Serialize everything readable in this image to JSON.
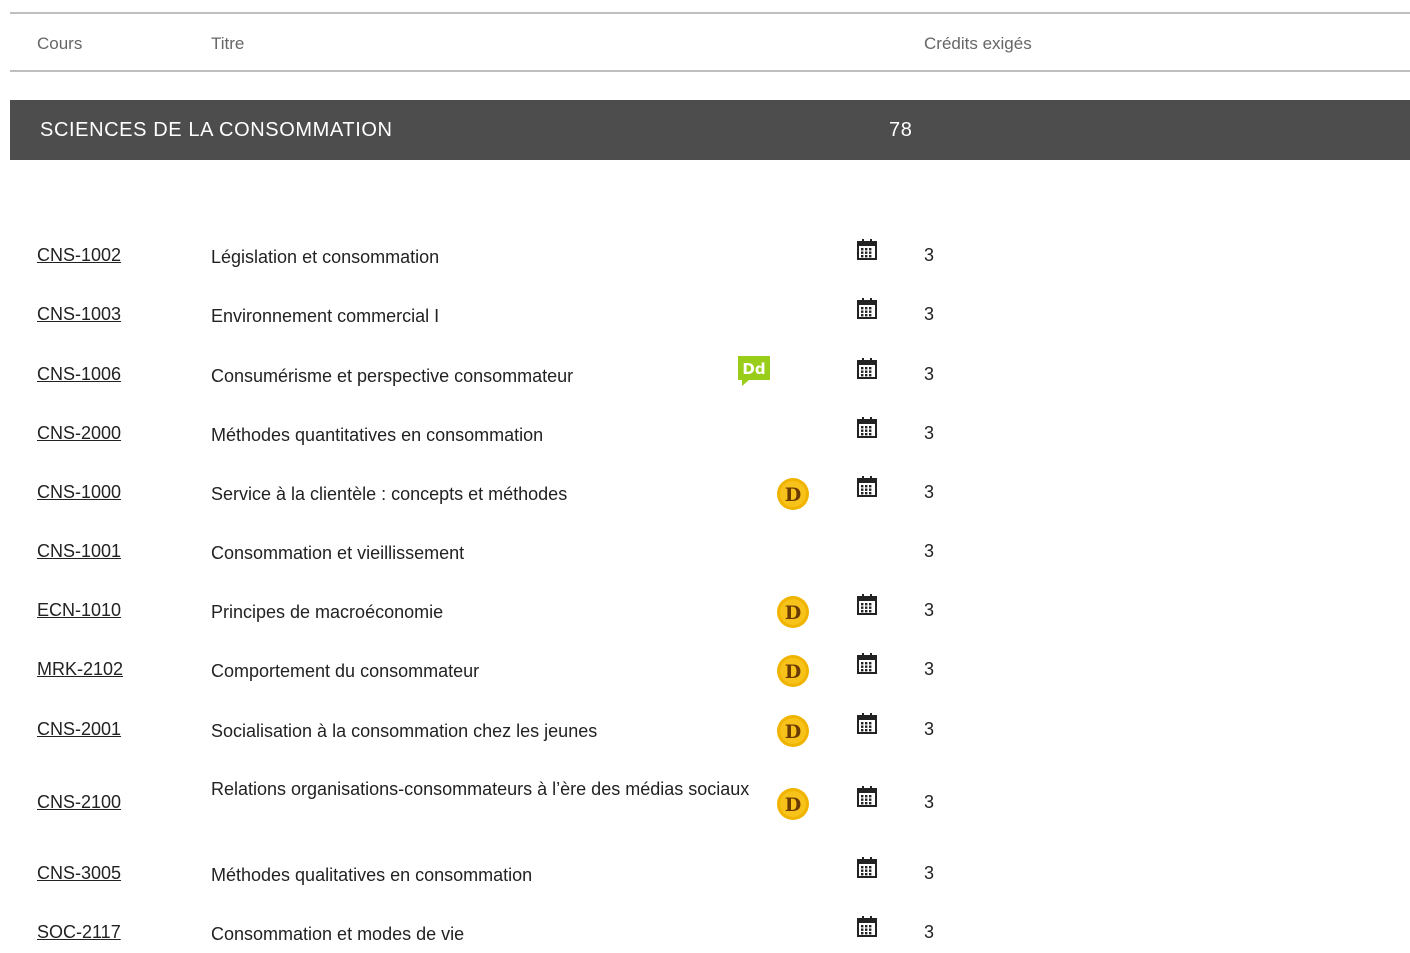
{
  "header": {
    "col_course": "Cours",
    "col_title": "Titre",
    "col_credits": "Crédits exigés"
  },
  "section": {
    "title": "SCIENCES DE LA CONSOMMATION",
    "credits": "78"
  },
  "colors": {
    "section_bar": "#4d4d4d",
    "d_badge": "#f0b400",
    "dd_badge": "#9acd1a"
  },
  "courses": [
    {
      "code": "CNS-1002",
      "title": "Législation et consommation",
      "credits": "3",
      "icons": [
        "calendar-icon"
      ]
    },
    {
      "code": "CNS-1003",
      "title": "Environnement commercial I",
      "credits": "3",
      "icons": [
        "calendar-icon"
      ]
    },
    {
      "code": "CNS-1006",
      "title": "Consumérisme et perspective consommateur",
      "credits": "3",
      "icons": [
        "dd-badge-icon",
        "calendar-icon"
      ]
    },
    {
      "code": "CNS-2000",
      "title": "Méthodes quantitatives en consommation",
      "credits": "3",
      "icons": [
        "calendar-icon"
      ]
    },
    {
      "code": "CNS-1000",
      "title": "Service à la clientèle : concepts et méthodes",
      "credits": "3",
      "icons": [
        "d-badge-icon",
        "calendar-icon"
      ]
    },
    {
      "code": "CNS-1001",
      "title": "Consommation et vieillissement",
      "credits": "3",
      "icons": []
    },
    {
      "code": "ECN-1010",
      "title": "Principes de macroéconomie",
      "credits": "3",
      "icons": [
        "d-badge-icon",
        "calendar-icon"
      ]
    },
    {
      "code": "MRK-2102",
      "title": "Comportement du consommateur",
      "credits": "3",
      "icons": [
        "d-badge-icon",
        "calendar-icon"
      ]
    },
    {
      "code": "CNS-2001",
      "title": "Socialisation à la consommation chez les jeunes",
      "credits": "3",
      "icons": [
        "d-badge-icon",
        "calendar-icon"
      ]
    },
    {
      "code": "CNS-2100",
      "title": "Relations organisations-consommateurs à l’ère des médias sociaux",
      "credits": "3",
      "icons": [
        "d-badge-icon",
        "calendar-icon"
      ]
    },
    {
      "code": "CNS-3005",
      "title": "Méthodes qualitatives en consommation",
      "credits": "3",
      "icons": [
        "calendar-icon"
      ]
    },
    {
      "code": "SOC-2117",
      "title": "Consommation et modes de vie",
      "credits": "3",
      "icons": [
        "calendar-icon"
      ]
    }
  ]
}
